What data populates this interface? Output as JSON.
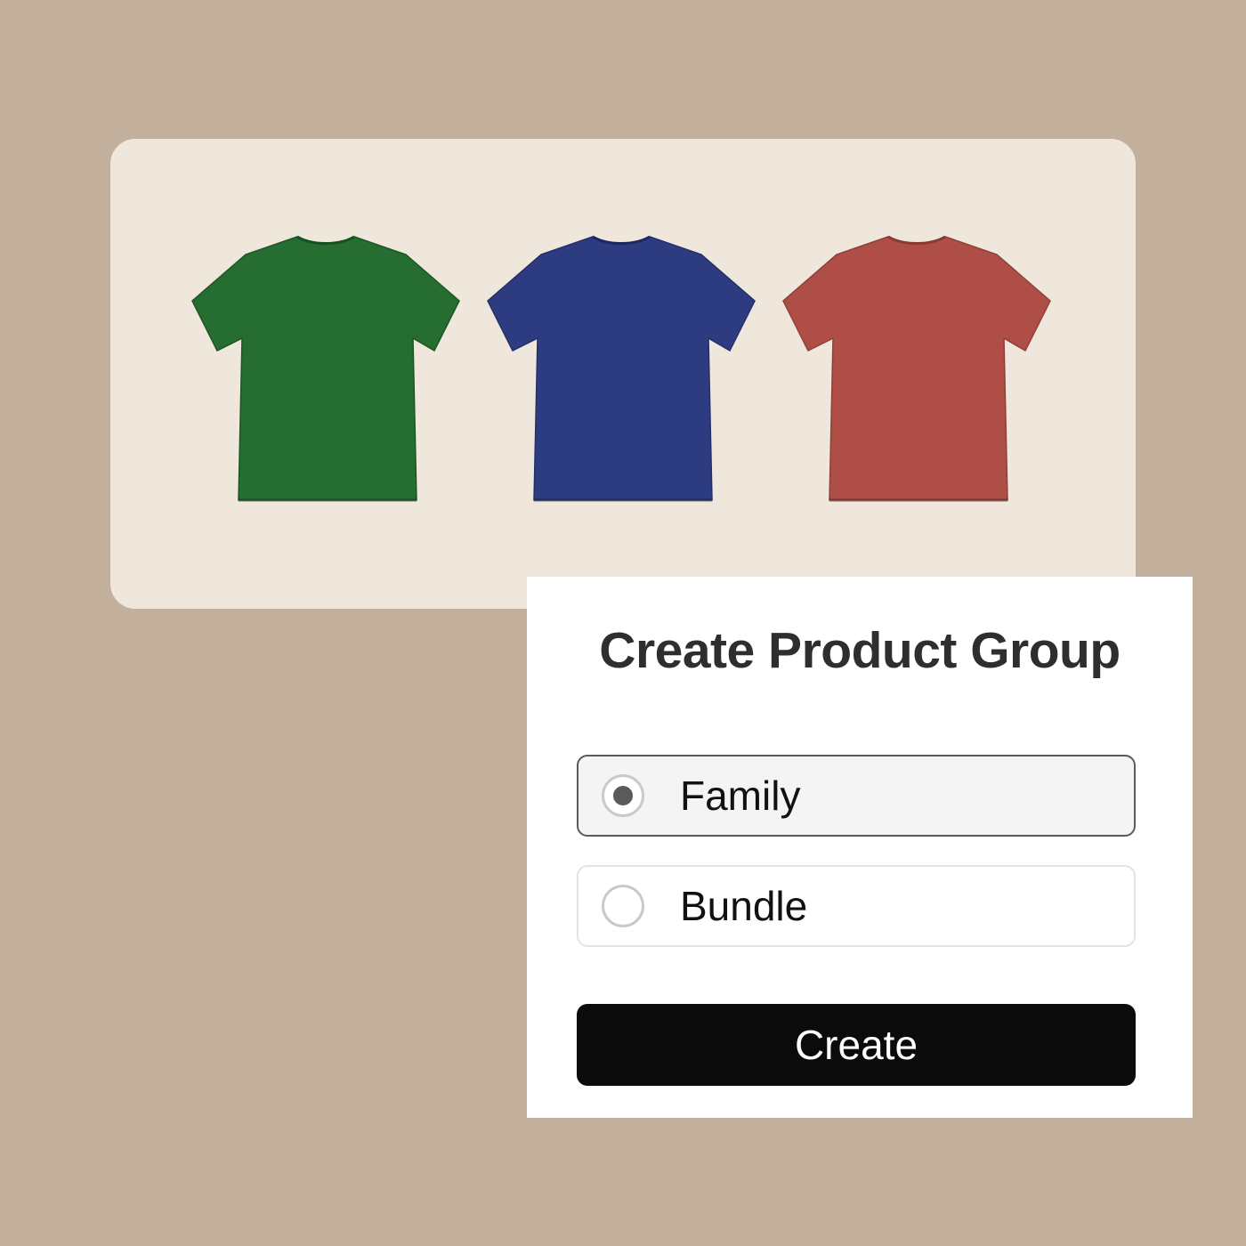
{
  "products": [
    {
      "name": "green-tshirt",
      "color": "#1f6a2c"
    },
    {
      "name": "blue-tshirt",
      "color": "#27367f"
    },
    {
      "name": "red-tshirt",
      "color": "#ad4a43"
    }
  ],
  "dialog": {
    "title": "Create Product Group",
    "options": [
      {
        "label": "Family",
        "selected": true
      },
      {
        "label": "Bundle",
        "selected": false
      }
    ],
    "submit_label": "Create"
  },
  "colors": {
    "background": "#c3b09c",
    "card": "#efe6dc",
    "button": "#0b0b0b"
  }
}
